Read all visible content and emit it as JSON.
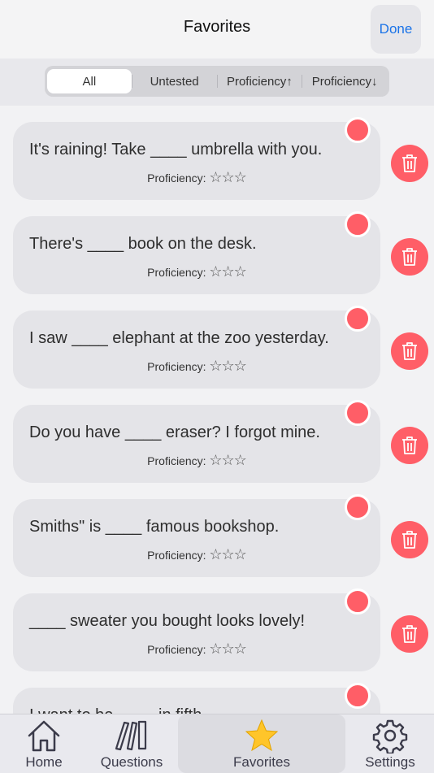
{
  "header": {
    "title": "Favorites",
    "done_label": "Done"
  },
  "filters": [
    "All",
    "Untested",
    "Proficiency↑",
    "Proficiency↓"
  ],
  "active_filter": "All",
  "proficiency_label": "Proficiency:",
  "stars": "☆☆☆",
  "items": [
    {
      "text": "It's raining! Take ____ umbrella with you."
    },
    {
      "text": "There's ____ book on the desk."
    },
    {
      "text": "I saw ____ elephant at the zoo yesterday."
    },
    {
      "text": "Do you have ____ eraser? I forgot mine."
    },
    {
      "text": "Smiths\" is ____ famous bookshop."
    },
    {
      "text": "____ sweater you bought looks lovely!"
    },
    {
      "text": "I want to be ____ in fifth."
    }
  ],
  "tabbar": {
    "tabs": [
      {
        "label": "Home",
        "icon": "home-icon"
      },
      {
        "label": "Questions",
        "icon": "books-icon"
      },
      {
        "label": "Favorites",
        "icon": "star-icon"
      },
      {
        "label": "Settings",
        "icon": "gear-icon"
      }
    ],
    "active": "Favorites",
    "accent_color": "#ffc52a"
  },
  "colors": {
    "delete": "#ff5e67",
    "link": "#1a73e8"
  }
}
